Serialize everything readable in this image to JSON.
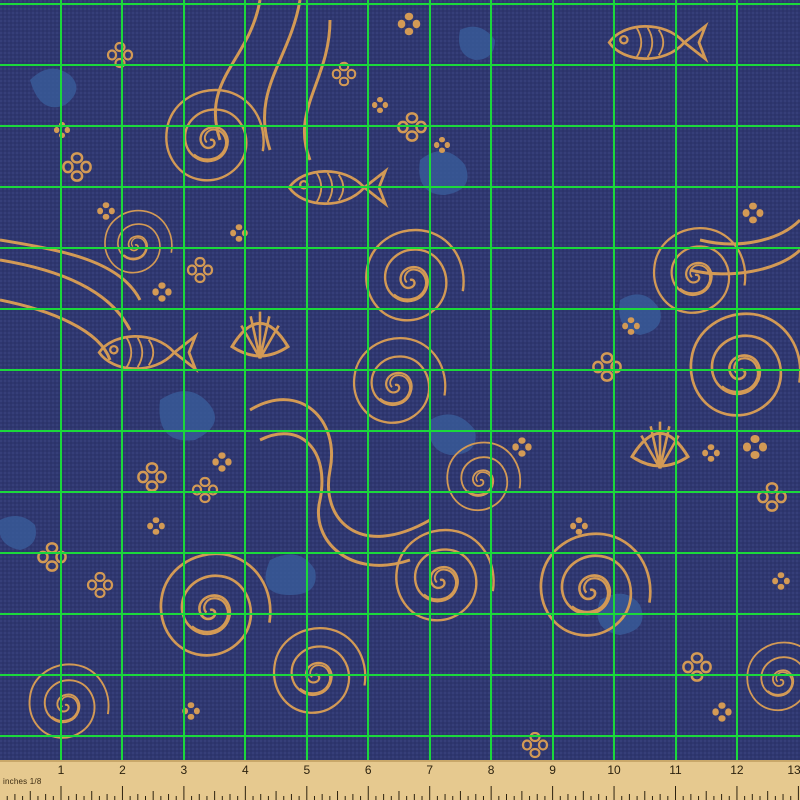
{
  "image": {
    "subject": "fabric swatch",
    "pattern": "ocean waves",
    "colors": {
      "background": "#2f3770",
      "texture_dark": "#293163",
      "texture_light": "#3a4b86",
      "blob": "#3a5f9c",
      "motif": "#d39a55",
      "grid_line": "#1bd83b",
      "ruler_wood": "#e6c98f",
      "ruler_ink": "#2c220f"
    },
    "motifs": [
      "fish-icon",
      "shell-icon",
      "flower-icon",
      "spiral-wave"
    ]
  },
  "ruler": {
    "unit_label": "inches 1/8",
    "numbers": [
      "1",
      "2",
      "3",
      "4",
      "5",
      "6",
      "7",
      "8",
      "9",
      "10",
      "11",
      "12",
      "13"
    ]
  }
}
